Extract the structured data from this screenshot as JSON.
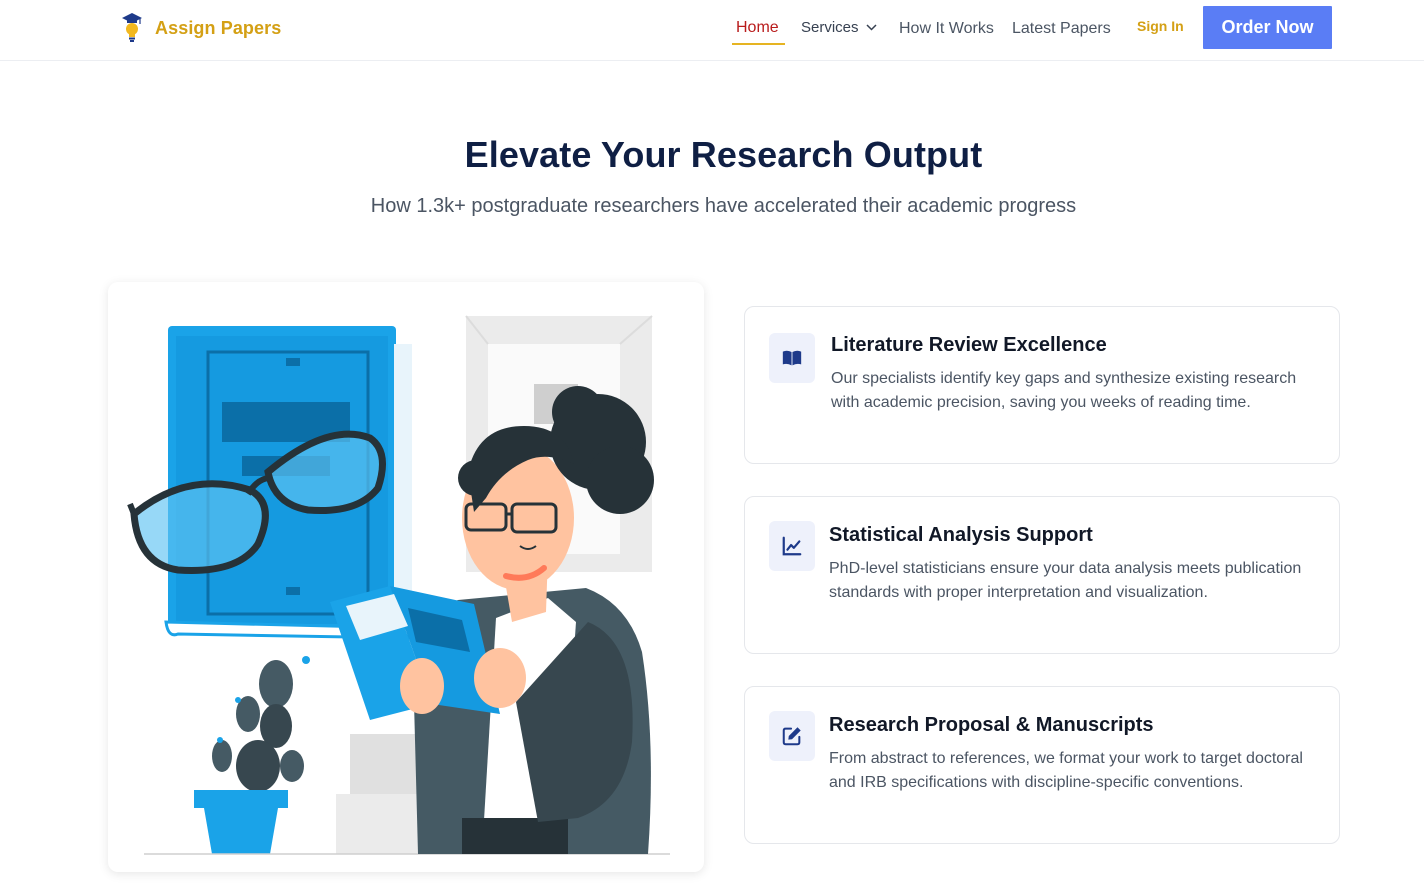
{
  "brand": {
    "name": "Assign Papers",
    "logo_icon": "lightbulb-graduation-icon",
    "color": "#d4a015"
  },
  "nav": {
    "home": "Home",
    "services": "Services",
    "how_it_works": "How It Works",
    "latest_papers": "Latest Papers",
    "sign_in": "Sign In",
    "order_now": "Order Now",
    "active": "Home"
  },
  "hero": {
    "title": "Elevate Your Research Output",
    "subtitle": "How 1.3k+ postgraduate researchers have accelerated their academic progress"
  },
  "illustration": {
    "description_icon": "woman-reading-book-illustration"
  },
  "features": [
    {
      "icon": "book-open-icon",
      "title": "Literature Review Excellence",
      "description": "Our specialists identify key gaps and synthesize existing research with academic precision, saving you weeks of reading time."
    },
    {
      "icon": "chart-line-icon",
      "title": "Statistical Analysis Support",
      "description": "PhD-level statisticians ensure your data analysis meets publication standards with proper interpretation and visualization."
    },
    {
      "icon": "edit-document-icon",
      "title": "Research Proposal & Manuscripts",
      "description": "From abstract to references, we format your work to target doctoral and IRB specifications with discipline-specific conventions."
    }
  ],
  "colors": {
    "accent_blue": "#5a7df5",
    "title_navy": "#0f1f44",
    "illustration_blue": "#1aa3e8",
    "home_red": "#b91c1c"
  }
}
